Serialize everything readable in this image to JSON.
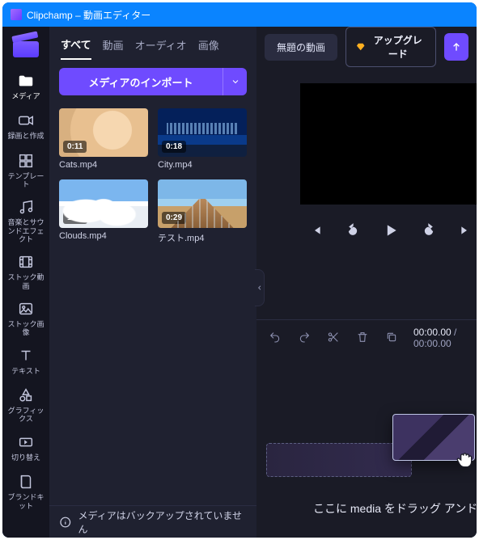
{
  "window": {
    "title": "Clipchamp – 動画エディター"
  },
  "sidebar": {
    "items": [
      {
        "id": "media",
        "label": "メディア"
      },
      {
        "id": "record",
        "label": "録画と作成"
      },
      {
        "id": "templates",
        "label": "テンプレー\nト"
      },
      {
        "id": "music",
        "label": "音楽とサウ\nンドエフェ\nクト"
      },
      {
        "id": "stockvideo",
        "label": "ストック動\n画"
      },
      {
        "id": "stockimage",
        "label": "ストック画\n像"
      },
      {
        "id": "text",
        "label": "テキスト"
      },
      {
        "id": "graphics",
        "label": "グラフィッ\nクス"
      },
      {
        "id": "transitions",
        "label": "切り替え"
      },
      {
        "id": "brandkit",
        "label": "ブランドキ\nット"
      }
    ]
  },
  "media_panel": {
    "tabs": [
      {
        "id": "all",
        "label": "すべて",
        "active": true
      },
      {
        "id": "video",
        "label": "動画"
      },
      {
        "id": "audio",
        "label": "オーディオ"
      },
      {
        "id": "image",
        "label": "画像"
      }
    ],
    "import_button": "メディアのインポート",
    "items": [
      {
        "name": "Cats.mp4",
        "duration": "0:11",
        "thumb": "cat"
      },
      {
        "name": "City.mp4",
        "duration": "0:18",
        "thumb": "city"
      },
      {
        "name": "Clouds.mp4",
        "duration": "1:05",
        "thumb": "clouds"
      },
      {
        "name": "テスト.mp4",
        "duration": "0:29",
        "thumb": "pier"
      }
    ],
    "backup_warning": "メディアはバックアップされていません"
  },
  "header": {
    "project_name": "無題の動画",
    "upgrade_label": "アップグレード"
  },
  "timeline": {
    "time_current": "00:00.00",
    "time_total": "00:00.00",
    "drop_hint": "ここに media をドラッグ アンド ドロ"
  }
}
